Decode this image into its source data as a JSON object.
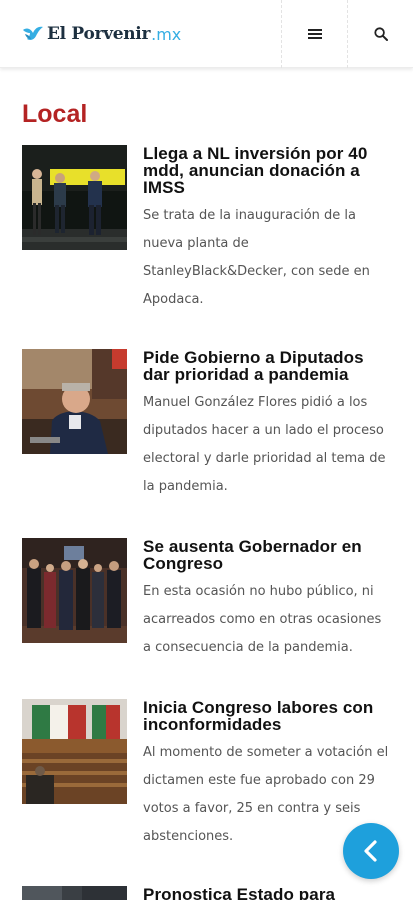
{
  "header": {
    "logo_name": "El Porvenir",
    "logo_tld": ".mx",
    "menu_icon": "hamburger-menu-icon",
    "search_icon": "search-icon"
  },
  "section": {
    "title": "Local"
  },
  "articles": [
    {
      "title": "Llega a NL inversión por 40 mdd, anuncian donación a IMSS",
      "description": "Se trata de la inauguración de la nueva planta de StanleyBlack&Decker, con sede en Apodaca."
    },
    {
      "title": "Pide Gobierno a Diputados dar prioridad a pandemia",
      "description": "Manuel González Flores pidió a los diputados hacer a un lado el proceso electoral y darle prioridad al tema de la pandemia."
    },
    {
      "title": "Se ausenta Gobernador en Congreso",
      "description": "En esta ocasión no hubo público, ni acarreados como en otras ocasiones a consecuencia de la pandemia."
    },
    {
      "title": "Inicia Congreso labores con inconformidades",
      "description": "Al momento de someter a votación el dictamen este fue aprobado con 29 votos a favor, 25 en contra y seis abstenciones."
    },
    {
      "title": "Pronostica Estado para",
      "description": ""
    }
  ],
  "fab": {
    "icon": "chevron-left-icon"
  },
  "colors": {
    "accent": "#1ea0dc",
    "section": "#b42323",
    "logo_tld": "#35aee3"
  }
}
